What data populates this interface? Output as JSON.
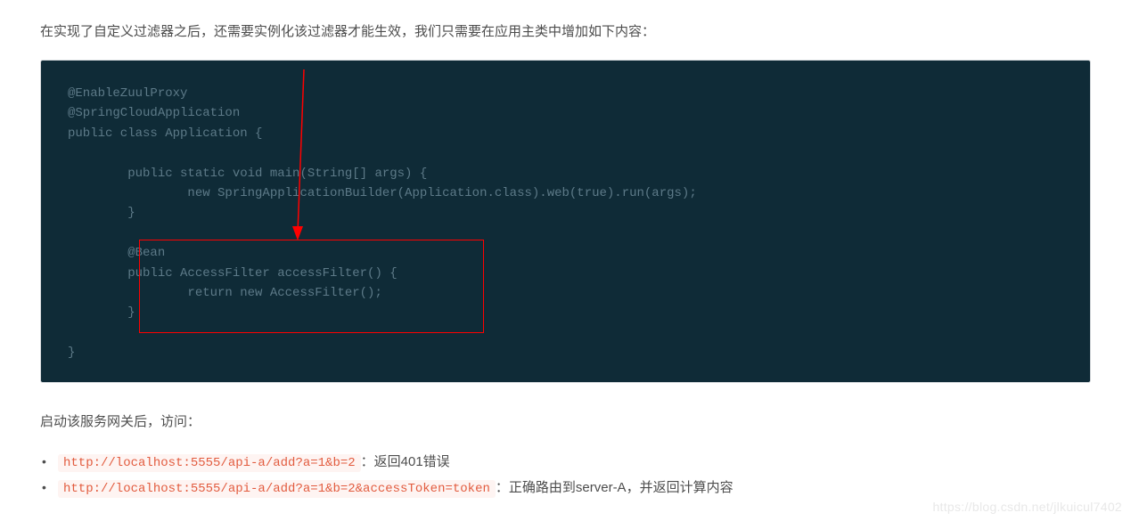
{
  "intro": "在实现了自定义过滤器之后，还需要实例化该过滤器才能生效，我们只需要在应用主类中增加如下内容：",
  "code": "@EnableZuulProxy\n@SpringCloudApplication\npublic class Application {\n\n        public static void main(String[] args) {\n                new SpringApplicationBuilder(Application.class).web(true).run(args);\n        }\n\n        @Bean\n        public AccessFilter accessFilter() {\n                return new AccessFilter();\n        }\n\n}",
  "after": "启动该服务网关后，访问：",
  "list": [
    {
      "url": "http://localhost:5555/api-a/add?a=1&b=2",
      "desc": "：返回401错误"
    },
    {
      "url": "http://localhost:5555/api-a/add?a=1&b=2&accessToken=token",
      "desc": "：正确路由到server-A，并返回计算内容"
    }
  ],
  "watermark": "https://blog.csdn.net/jlkuicul7402"
}
